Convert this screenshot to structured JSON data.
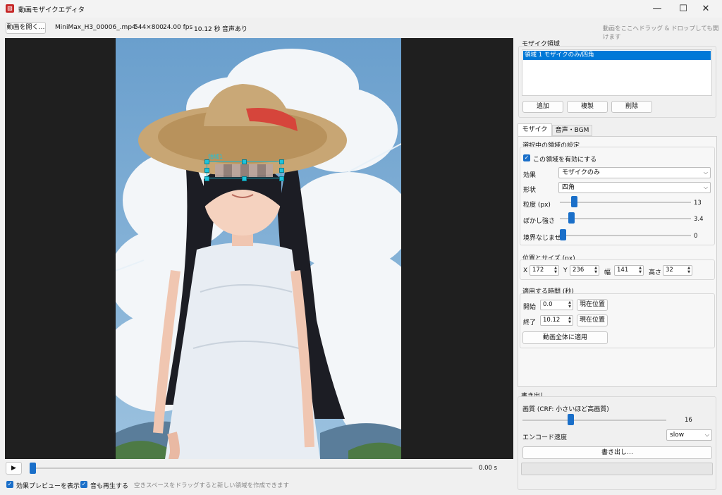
{
  "window": {
    "title": "動画モザイクエディタ",
    "app_icon": "▨",
    "minimize": "—",
    "maximize": "☐",
    "close": "✕"
  },
  "toolbar": {
    "open_button": "動画を開く…",
    "file_name": "MiniMax_H3_00006_.mp4",
    "resolution": "544×800",
    "fps": "24.00 fps",
    "duration": "10.12 秒",
    "audio": "音声あり",
    "drop_hint": "動画をここへドラッグ & ドロップしても開けます"
  },
  "preview": {
    "selection_label": "領域1",
    "play_icon": "▶",
    "time": "0.00 s",
    "playback_progress": 0.0,
    "show_effect_label": "効果プレビューを表示",
    "play_audio_label": "音も再生する",
    "hint": "空きスペースをドラッグすると新しい領域を作成できます"
  },
  "regions": {
    "group_title": "モザイク領域",
    "items": [
      "領域 1  モザイクのみ/四角"
    ],
    "add_button": "追加",
    "duplicate_button": "複製",
    "delete_button": "削除"
  },
  "tabs": {
    "mosaic": "モザイク",
    "audio_bgm": "音声・BGM",
    "active": "モザイク"
  },
  "settings": {
    "group_title": "選択中の領域の設定",
    "enable_label": "この領域を有効にする",
    "effect_label": "効果",
    "effect_value": "モザイクのみ",
    "shape_label": "形状",
    "shape_value": "四角",
    "granularity_label": "粒度 (px)",
    "granularity_value": "13",
    "blur_label": "ぼかし強さ",
    "blur_value": "3.4",
    "feather_label": "境界なじませ",
    "feather_value": "0"
  },
  "position": {
    "group_title": "位置とサイズ (px)",
    "x_label": "X",
    "x_value": "172",
    "y_label": "Y",
    "y_value": "236",
    "w_label": "幅",
    "w_value": "141",
    "h_label": "高さ",
    "h_value": "32"
  },
  "time_range": {
    "group_title": "適用する時間 (秒)",
    "start_label": "開始",
    "start_value": "0.0",
    "end_label": "終了",
    "end_value": "10.12",
    "current_button": "現在位置",
    "apply_all_button": "動画全体に適用"
  },
  "export": {
    "group_title": "書き出し",
    "quality_label": "画質 (CRF: 小さいほど高画質)",
    "quality_value": "16",
    "speed_label": "エンコード速度",
    "speed_value": "slow",
    "export_button": "書き出し…"
  },
  "colors": {
    "accent": "#1a6fc9",
    "selection": "#18b8d2",
    "list_highlight": "#0078d7"
  }
}
